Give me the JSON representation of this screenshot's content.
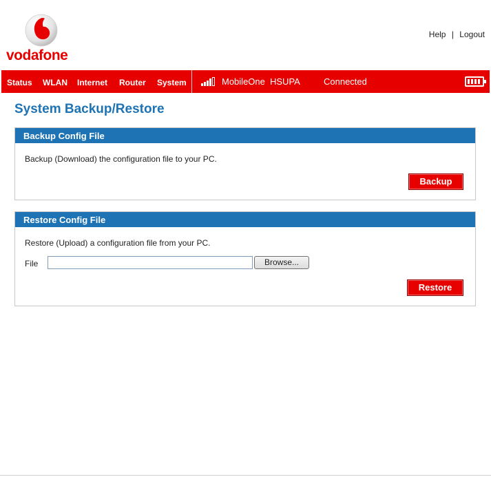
{
  "brand": {
    "name": "vodafone",
    "color": "#e60000"
  },
  "toplinks": {
    "help": "Help",
    "separator": "|",
    "logout": "Logout"
  },
  "nav": {
    "items": [
      "Status",
      "WLAN",
      "Internet",
      "Router",
      "System"
    ],
    "network_name": "MobileOne",
    "network_type": "HSUPA",
    "connection_status": "Connected",
    "signal_icon": "signal-bars-icon",
    "battery_icon": "battery-icon"
  },
  "page": {
    "title": "System Backup/Restore"
  },
  "backup": {
    "header": "Backup Config File",
    "description": "Backup (Download) the configuration file to your PC.",
    "button": "Backup"
  },
  "restore": {
    "header": "Restore Config File",
    "description": "Restore (Upload) a configuration file from your PC.",
    "file_label": "File",
    "file_value": "",
    "browse_button": "Browse...",
    "button": "Restore"
  },
  "colors": {
    "accent_blue": "#1e73b4",
    "brand_red": "#e60000"
  }
}
